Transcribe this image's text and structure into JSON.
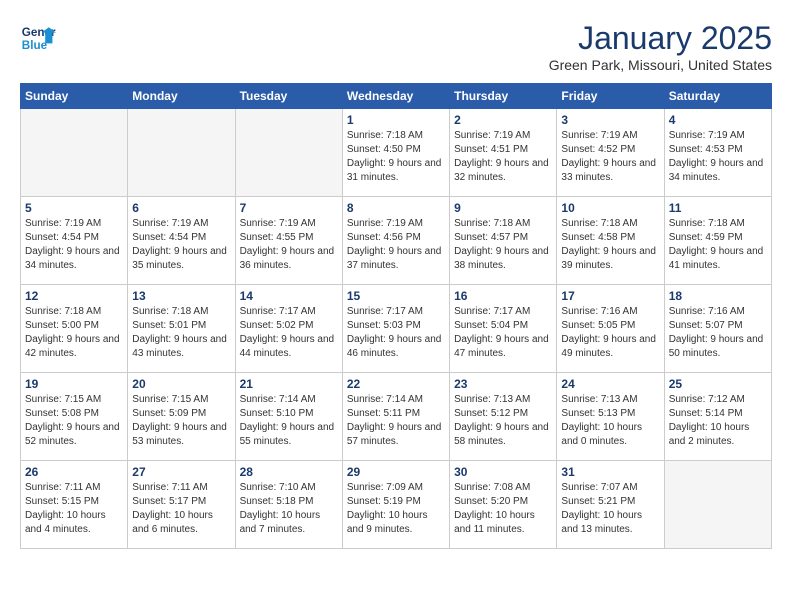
{
  "logo": {
    "line1": "General",
    "line2": "Blue"
  },
  "title": "January 2025",
  "location": "Green Park, Missouri, United States",
  "weekdays": [
    "Sunday",
    "Monday",
    "Tuesday",
    "Wednesday",
    "Thursday",
    "Friday",
    "Saturday"
  ],
  "weeks": [
    [
      {
        "day": "",
        "sunrise": "",
        "sunset": "",
        "daylight": ""
      },
      {
        "day": "",
        "sunrise": "",
        "sunset": "",
        "daylight": ""
      },
      {
        "day": "",
        "sunrise": "",
        "sunset": "",
        "daylight": ""
      },
      {
        "day": "1",
        "sunrise": "Sunrise: 7:18 AM",
        "sunset": "Sunset: 4:50 PM",
        "daylight": "Daylight: 9 hours and 31 minutes."
      },
      {
        "day": "2",
        "sunrise": "Sunrise: 7:19 AM",
        "sunset": "Sunset: 4:51 PM",
        "daylight": "Daylight: 9 hours and 32 minutes."
      },
      {
        "day": "3",
        "sunrise": "Sunrise: 7:19 AM",
        "sunset": "Sunset: 4:52 PM",
        "daylight": "Daylight: 9 hours and 33 minutes."
      },
      {
        "day": "4",
        "sunrise": "Sunrise: 7:19 AM",
        "sunset": "Sunset: 4:53 PM",
        "daylight": "Daylight: 9 hours and 34 minutes."
      }
    ],
    [
      {
        "day": "5",
        "sunrise": "Sunrise: 7:19 AM",
        "sunset": "Sunset: 4:54 PM",
        "daylight": "Daylight: 9 hours and 34 minutes."
      },
      {
        "day": "6",
        "sunrise": "Sunrise: 7:19 AM",
        "sunset": "Sunset: 4:54 PM",
        "daylight": "Daylight: 9 hours and 35 minutes."
      },
      {
        "day": "7",
        "sunrise": "Sunrise: 7:19 AM",
        "sunset": "Sunset: 4:55 PM",
        "daylight": "Daylight: 9 hours and 36 minutes."
      },
      {
        "day": "8",
        "sunrise": "Sunrise: 7:19 AM",
        "sunset": "Sunset: 4:56 PM",
        "daylight": "Daylight: 9 hours and 37 minutes."
      },
      {
        "day": "9",
        "sunrise": "Sunrise: 7:18 AM",
        "sunset": "Sunset: 4:57 PM",
        "daylight": "Daylight: 9 hours and 38 minutes."
      },
      {
        "day": "10",
        "sunrise": "Sunrise: 7:18 AM",
        "sunset": "Sunset: 4:58 PM",
        "daylight": "Daylight: 9 hours and 39 minutes."
      },
      {
        "day": "11",
        "sunrise": "Sunrise: 7:18 AM",
        "sunset": "Sunset: 4:59 PM",
        "daylight": "Daylight: 9 hours and 41 minutes."
      }
    ],
    [
      {
        "day": "12",
        "sunrise": "Sunrise: 7:18 AM",
        "sunset": "Sunset: 5:00 PM",
        "daylight": "Daylight: 9 hours and 42 minutes."
      },
      {
        "day": "13",
        "sunrise": "Sunrise: 7:18 AM",
        "sunset": "Sunset: 5:01 PM",
        "daylight": "Daylight: 9 hours and 43 minutes."
      },
      {
        "day": "14",
        "sunrise": "Sunrise: 7:17 AM",
        "sunset": "Sunset: 5:02 PM",
        "daylight": "Daylight: 9 hours and 44 minutes."
      },
      {
        "day": "15",
        "sunrise": "Sunrise: 7:17 AM",
        "sunset": "Sunset: 5:03 PM",
        "daylight": "Daylight: 9 hours and 46 minutes."
      },
      {
        "day": "16",
        "sunrise": "Sunrise: 7:17 AM",
        "sunset": "Sunset: 5:04 PM",
        "daylight": "Daylight: 9 hours and 47 minutes."
      },
      {
        "day": "17",
        "sunrise": "Sunrise: 7:16 AM",
        "sunset": "Sunset: 5:05 PM",
        "daylight": "Daylight: 9 hours and 49 minutes."
      },
      {
        "day": "18",
        "sunrise": "Sunrise: 7:16 AM",
        "sunset": "Sunset: 5:07 PM",
        "daylight": "Daylight: 9 hours and 50 minutes."
      }
    ],
    [
      {
        "day": "19",
        "sunrise": "Sunrise: 7:15 AM",
        "sunset": "Sunset: 5:08 PM",
        "daylight": "Daylight: 9 hours and 52 minutes."
      },
      {
        "day": "20",
        "sunrise": "Sunrise: 7:15 AM",
        "sunset": "Sunset: 5:09 PM",
        "daylight": "Daylight: 9 hours and 53 minutes."
      },
      {
        "day": "21",
        "sunrise": "Sunrise: 7:14 AM",
        "sunset": "Sunset: 5:10 PM",
        "daylight": "Daylight: 9 hours and 55 minutes."
      },
      {
        "day": "22",
        "sunrise": "Sunrise: 7:14 AM",
        "sunset": "Sunset: 5:11 PM",
        "daylight": "Daylight: 9 hours and 57 minutes."
      },
      {
        "day": "23",
        "sunrise": "Sunrise: 7:13 AM",
        "sunset": "Sunset: 5:12 PM",
        "daylight": "Daylight: 9 hours and 58 minutes."
      },
      {
        "day": "24",
        "sunrise": "Sunrise: 7:13 AM",
        "sunset": "Sunset: 5:13 PM",
        "daylight": "Daylight: 10 hours and 0 minutes."
      },
      {
        "day": "25",
        "sunrise": "Sunrise: 7:12 AM",
        "sunset": "Sunset: 5:14 PM",
        "daylight": "Daylight: 10 hours and 2 minutes."
      }
    ],
    [
      {
        "day": "26",
        "sunrise": "Sunrise: 7:11 AM",
        "sunset": "Sunset: 5:15 PM",
        "daylight": "Daylight: 10 hours and 4 minutes."
      },
      {
        "day": "27",
        "sunrise": "Sunrise: 7:11 AM",
        "sunset": "Sunset: 5:17 PM",
        "daylight": "Daylight: 10 hours and 6 minutes."
      },
      {
        "day": "28",
        "sunrise": "Sunrise: 7:10 AM",
        "sunset": "Sunset: 5:18 PM",
        "daylight": "Daylight: 10 hours and 7 minutes."
      },
      {
        "day": "29",
        "sunrise": "Sunrise: 7:09 AM",
        "sunset": "Sunset: 5:19 PM",
        "daylight": "Daylight: 10 hours and 9 minutes."
      },
      {
        "day": "30",
        "sunrise": "Sunrise: 7:08 AM",
        "sunset": "Sunset: 5:20 PM",
        "daylight": "Daylight: 10 hours and 11 minutes."
      },
      {
        "day": "31",
        "sunrise": "Sunrise: 7:07 AM",
        "sunset": "Sunset: 5:21 PM",
        "daylight": "Daylight: 10 hours and 13 minutes."
      },
      {
        "day": "",
        "sunrise": "",
        "sunset": "",
        "daylight": ""
      }
    ]
  ]
}
